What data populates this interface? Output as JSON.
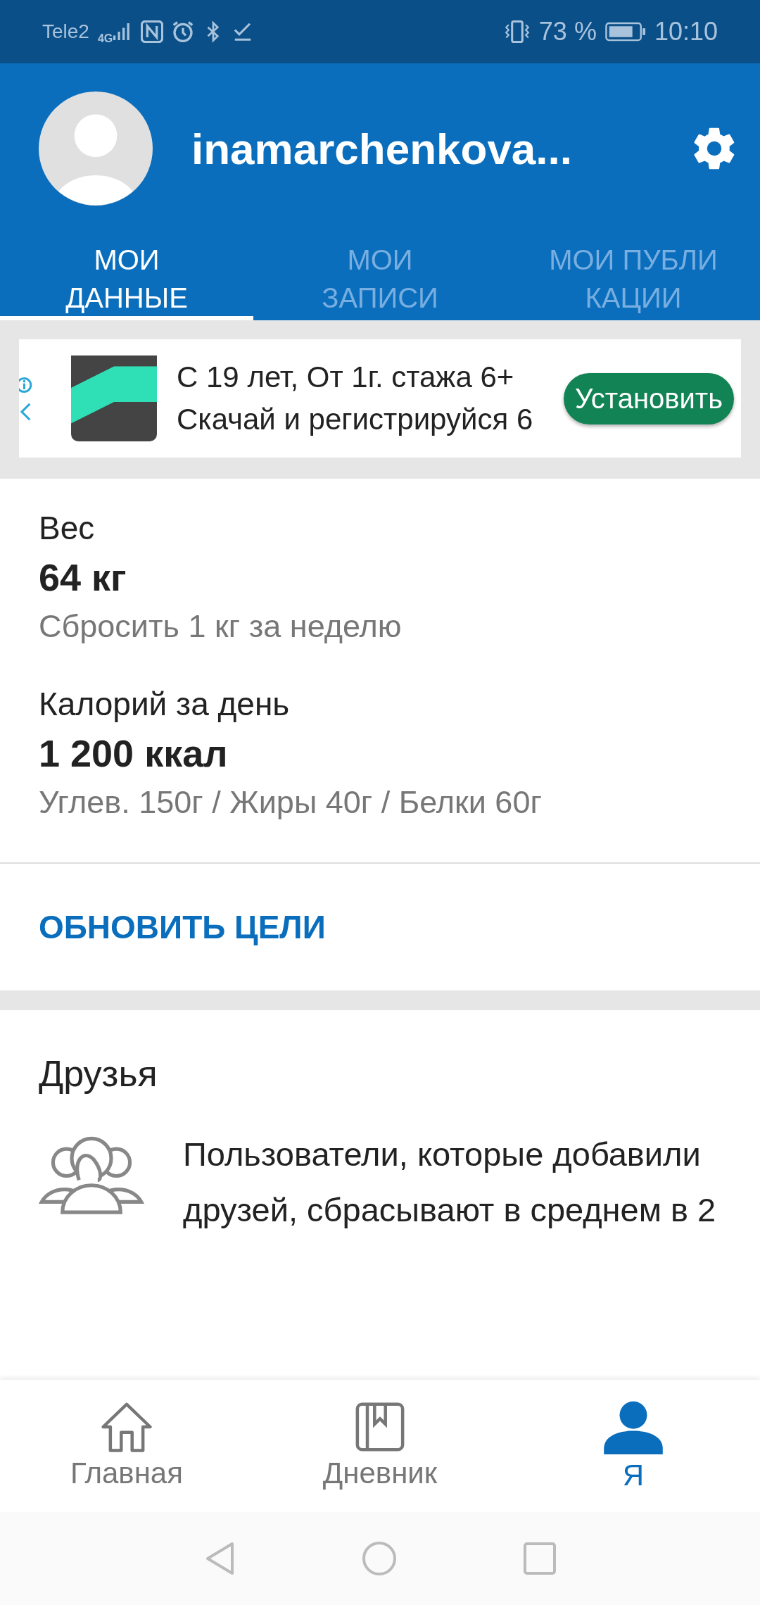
{
  "status_bar": {
    "carrier": "Tele2",
    "network": "4G",
    "battery": "73 %",
    "time": "10:10"
  },
  "profile": {
    "username": "inamarchenkova..."
  },
  "tabs": [
    {
      "label": "МОИ ДАННЫЕ",
      "selected": true
    },
    {
      "label": "МОИ ЗАПИСИ",
      "selected": false
    },
    {
      "label": "МОИ ПУБЛИ КАЦИИ",
      "selected": false
    }
  ],
  "ad": {
    "line_1": "С 19 лет, От 1г. стажа 6+",
    "line_2": "Скачай и регистрируйся 6",
    "button": "Установить"
  },
  "goals": [
    {
      "label": "Вес",
      "value": "64 кг",
      "detail": "Сбросить 1 кг за неделю"
    },
    {
      "label": "Калорий за день",
      "value": "1 200 ккал",
      "detail": "Углев. 150г / Жиры 40г / Белки 60г"
    }
  ],
  "update_goals": "ОБНОВИТЬ ЦЕЛИ",
  "friends": {
    "title": "Друзья",
    "text": "Пользователи, которые добавили друзей, сбрасывают в среднем в 2"
  },
  "bottom_nav": [
    {
      "label": "Главная",
      "kind": "home",
      "selected": false
    },
    {
      "label": "Дневник",
      "kind": "diary",
      "selected": false
    },
    {
      "label": "Я",
      "kind": "me",
      "selected": true
    }
  ]
}
